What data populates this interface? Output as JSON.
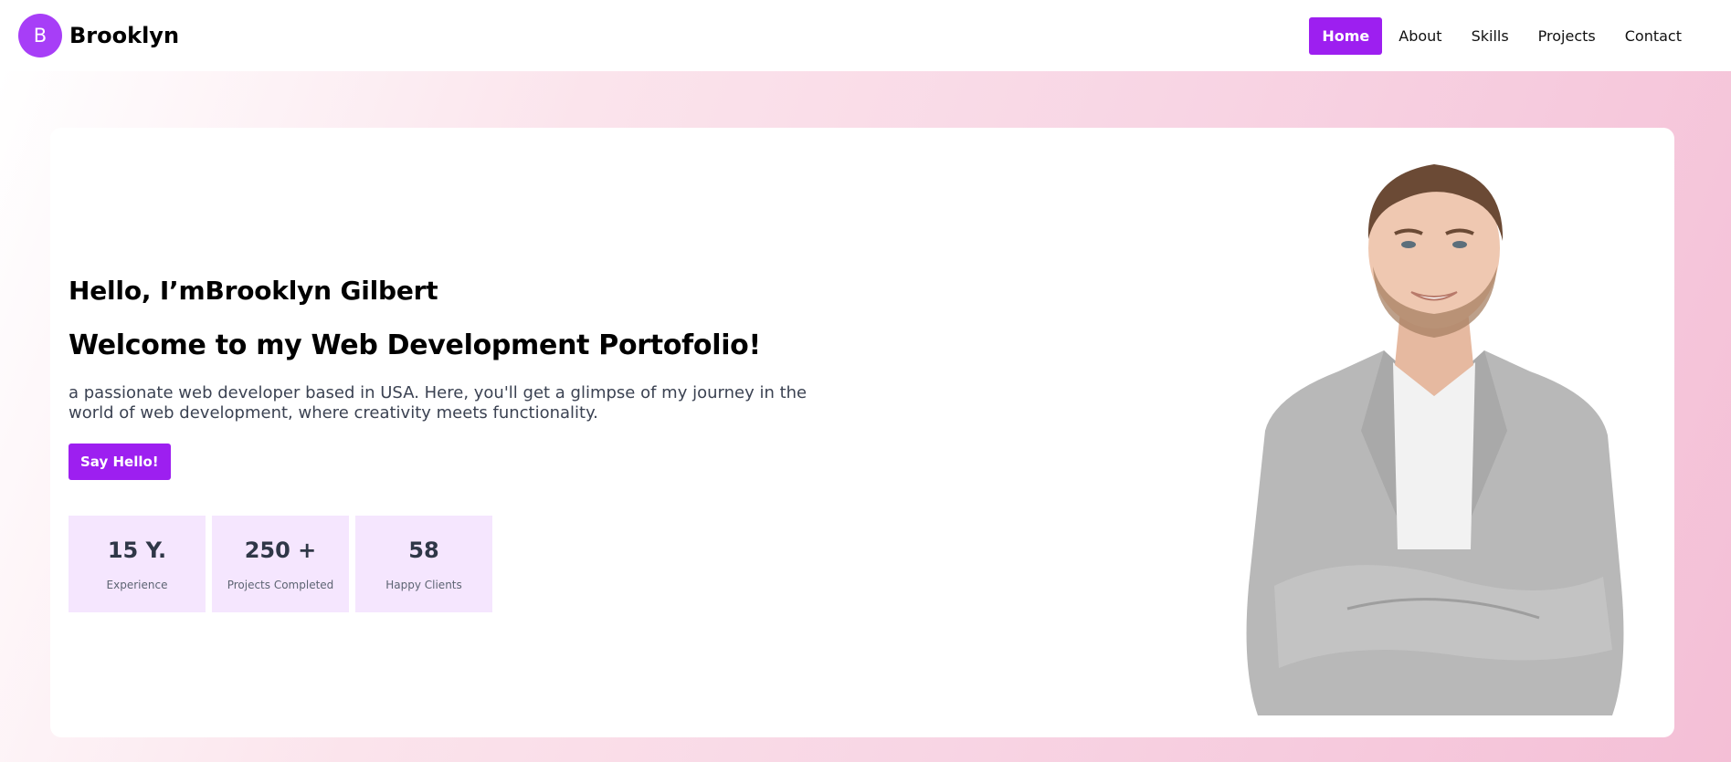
{
  "header": {
    "logo_letter": "B",
    "brand": "Brooklyn",
    "nav": [
      {
        "label": "Home",
        "active": true
      },
      {
        "label": "About",
        "active": false
      },
      {
        "label": "Skills",
        "active": false
      },
      {
        "label": "Projects",
        "active": false
      },
      {
        "label": "Contact",
        "active": false
      }
    ]
  },
  "hero": {
    "hello": "Hello, I’mBrooklyn Gilbert",
    "welcome": "Welcome to my Web Development Portofolio!",
    "tagline": "a passionate web developer based in USA. Here, you'll get a glimpse of my journey in the world of web development, where creativity meets functionality.",
    "cta_label": "Say Hello!",
    "stats": [
      {
        "value": "15 Y.",
        "label": "Experience"
      },
      {
        "value": "250 +",
        "label": "Projects Completed"
      },
      {
        "value": "58",
        "label": "Happy Clients"
      }
    ],
    "portrait": "man-in-grey-blazer-arms-crossed-photo"
  },
  "colors": {
    "accent": "#9d1ff0",
    "logo": "#a73ef7",
    "stat_bg": "#f5e6fe",
    "gradient_end": "#f4bfd6"
  }
}
